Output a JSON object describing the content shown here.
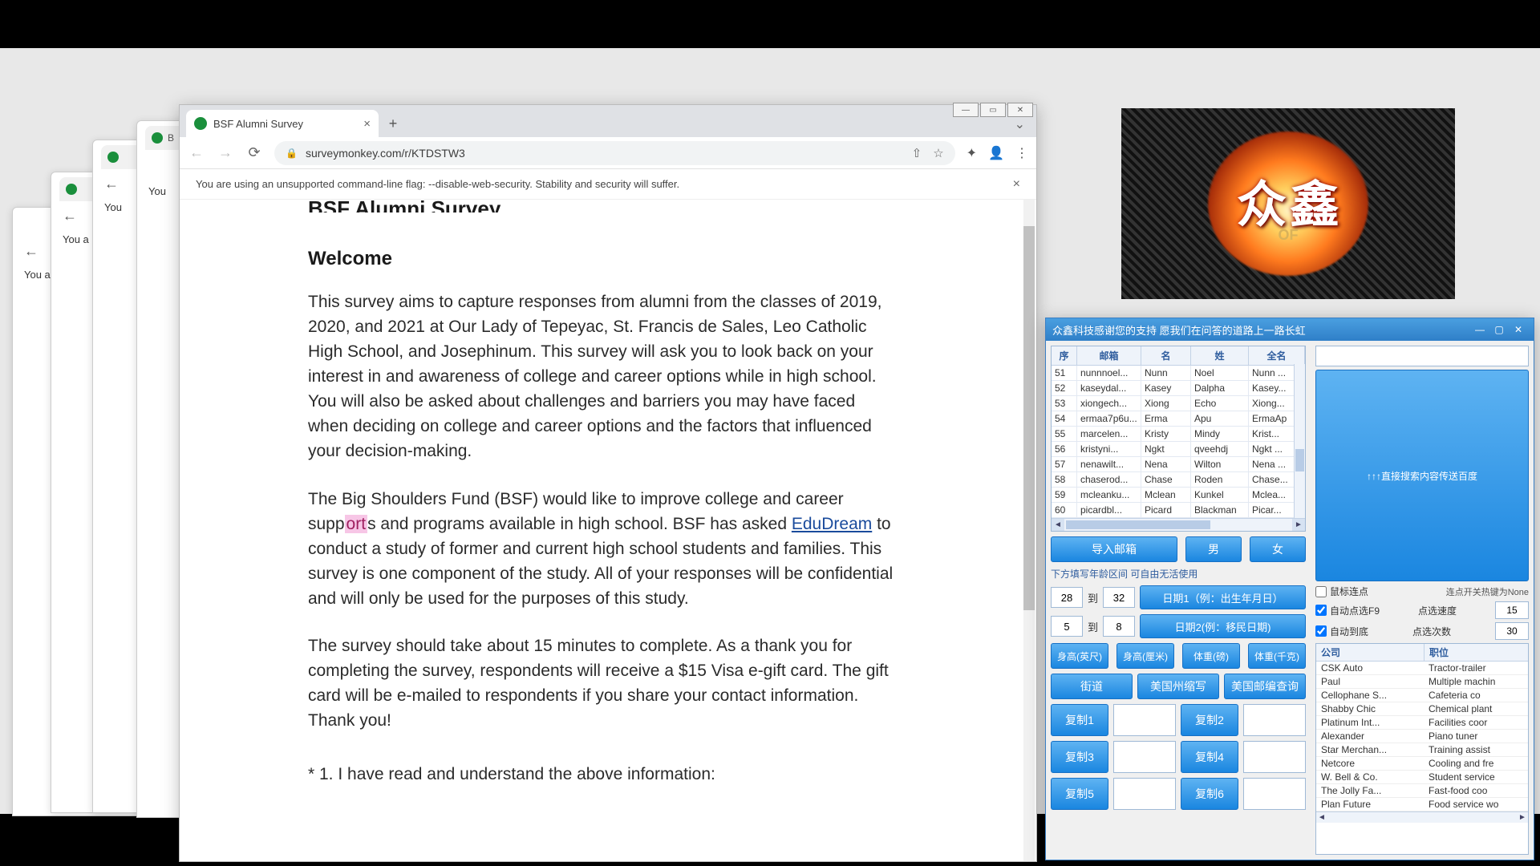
{
  "browser": {
    "tab_title": "BSF Alumni Survey",
    "url": "surveymonkey.com/r/KTDSTW3",
    "flag_warning": "You are using an unsupported command-line flag: --disable-web-security. Stability and security will suffer.",
    "bg_flag_short": "You a",
    "bg_flag_mid": "You"
  },
  "survey": {
    "title": "BSF Alumni Survey",
    "welcome": "Welcome",
    "p1": "This survey aims to capture responses from alumni from the classes of 2019, 2020, and 2021 at Our Lady of Tepeyac, St. Francis de Sales, Leo Catholic High School, and Josephinum. This survey will ask you to look back on your interest in and awareness of college and career options while in high school.  You will also be asked about challenges and barriers you may have faced when deciding on college and career options and the factors that influenced your decision-making.",
    "p2a": "The Big Shoulders Fund (BSF) would like to improve college and career supp",
    "p2_hl": "ort",
    "p2b": "s and programs available in high school. BSF has asked ",
    "p2_link": "EduDream",
    "p2c": " to conduct a study of former and current high school students and families. This survey is one component of the study. All of your responses will be confidential and will only be used for the purposes of this study.",
    "p3": "The survey should take about 15 minutes to complete. As a thank you for completing the survey, respondents will receive a $15 Visa e-gift card. The gift card will be e-mailed to respondents if you share your contact information. Thank you!",
    "q1": "* 1. I have read and understand the above information:"
  },
  "logo": {
    "char1": "众",
    "char2": "鑫",
    "of": "OF"
  },
  "tool": {
    "title": "众鑫科技感谢您的支持 愿我们在问答的道路上一路长虹",
    "grid_head": [
      "序",
      "邮箱",
      "名",
      "姓",
      "全名"
    ],
    "rows": [
      [
        "51",
        "nunnnoel...",
        "Nunn",
        "Noel",
        "Nunn ..."
      ],
      [
        "52",
        "kaseydal...",
        "Kasey",
        "Dalpha",
        "Kasey..."
      ],
      [
        "53",
        "xiongech...",
        "Xiong",
        "Echo",
        "Xiong..."
      ],
      [
        "54",
        "ermaa7p6u...",
        "Erma",
        "Apu",
        "ErmaAp"
      ],
      [
        "55",
        "marcelen...",
        "Kristy",
        "Mindy",
        "Krist..."
      ],
      [
        "56",
        "kristyni...",
        "Ngkt",
        "qveehdj",
        "Ngkt ..."
      ],
      [
        "57",
        "nenawilt...",
        "Nena",
        "Wilton",
        "Nena ..."
      ],
      [
        "58",
        "chaserod...",
        "Chase",
        "Roden",
        "Chase..."
      ],
      [
        "59",
        "mcleanku...",
        "Mclean",
        "Kunkel",
        "Mclea..."
      ],
      [
        "60",
        "picardbl...",
        "Picard",
        "Blackman",
        "Picar..."
      ]
    ],
    "import_btn": "导入邮箱",
    "male_btn": "男",
    "female_btn": "女",
    "hint": "下方填写年龄区间 可自由无活使用",
    "age_from": "28",
    "age_to": "32",
    "to_lbl": "到",
    "date1_btn": "日期1（例：出生年月日）",
    "m_from": "5",
    "m_to": "8",
    "date2_btn": "日期2(例：移民日期)",
    "body_btns": [
      "身高(英尺)",
      "身高(厘米)",
      "体重(磅)",
      "体重(千克)"
    ],
    "wide_btns": [
      "街道",
      "美国州缩写",
      "美国邮编查询"
    ],
    "copy": [
      "复制1",
      "复制2",
      "复制3",
      "复制4",
      "复制5",
      "复制6"
    ],
    "search_btn": "↑↑↑直接搜索内容传送百度",
    "chk1": "鼠标连点",
    "chk1_hint": "连点开关热键为None",
    "chk2": "自动点选F9",
    "chk2_lbl": "点选速度",
    "chk2_val": "15",
    "chk3": "自动到底",
    "chk3_lbl": "点选次数",
    "chk3_val": "30",
    "rlist_head": [
      "公司",
      "职位"
    ],
    "rlist_rows": [
      [
        "CSK Auto",
        "Tractor-trailer"
      ],
      [
        "Paul",
        "Multiple machin"
      ],
      [
        "Cellophane S...",
        "Cafeteria co"
      ],
      [
        "Shabby Chic",
        "Chemical plant"
      ],
      [
        "Platinum Int...",
        "Facilities coor"
      ],
      [
        "Alexander",
        "Piano tuner"
      ],
      [
        "Star Merchan...",
        "Training assist"
      ],
      [
        "Netcore",
        "Cooling and fre"
      ],
      [
        "W. Bell & Co.",
        "Student service"
      ],
      [
        "The Jolly Fa...",
        "Fast-food coo"
      ],
      [
        "Plan Future",
        "Food service wo"
      ]
    ]
  }
}
